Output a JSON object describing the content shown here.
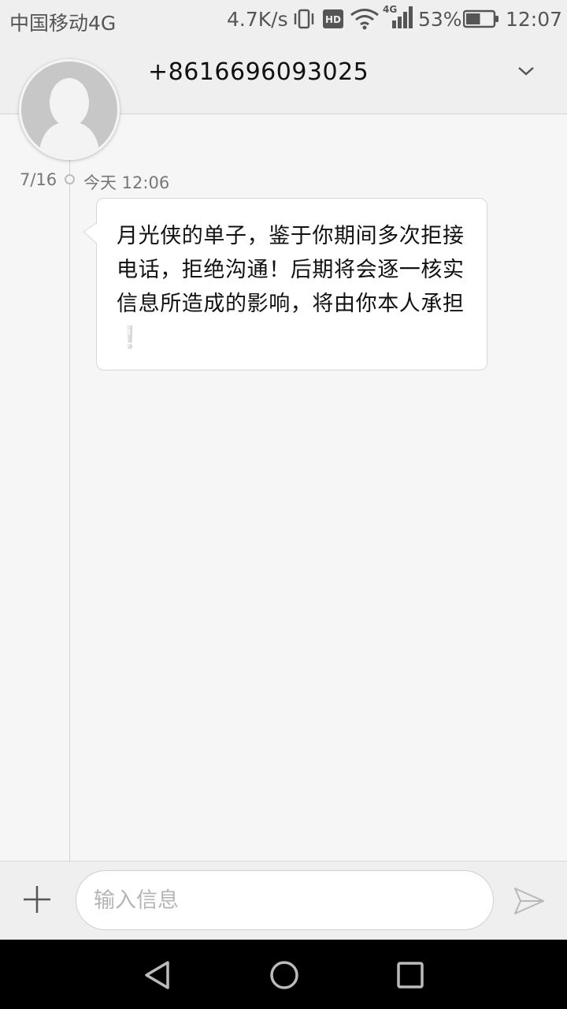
{
  "status_bar": {
    "carrier": "中国移动4G",
    "network_speed": "4.7K/s",
    "hd_badge": "HD",
    "network_type": "4G",
    "battery_percent": "53%",
    "battery_level": 0.53,
    "time": "12:07",
    "icons": [
      "vibrate-icon",
      "hd-icon",
      "wifi-icon",
      "signal-icon",
      "battery-icon"
    ]
  },
  "header": {
    "contact_number": "+8616696093025",
    "expand_icon": "chevron-down-icon",
    "avatar_icon": "person-silhouette-icon"
  },
  "conversation": {
    "date": "7/16",
    "time": "今天 12:06",
    "message": {
      "text": "月光侠的单子，鉴于你期间多次拒接电话，拒绝沟通！后期将会逐一核实信息所造成的影响，将由你本人承担",
      "emoji": "❕"
    }
  },
  "composer": {
    "placeholder": "输入信息",
    "add_icon": "plus-icon",
    "send_icon": "send-icon"
  },
  "navigation": {
    "back_icon": "back-triangle-icon",
    "home_icon": "home-circle-icon",
    "recents_icon": "recents-square-icon"
  },
  "colors": {
    "background": "#f6f6f6",
    "bar": "#efefef",
    "emoji_accent": "#3cb4e6",
    "nav": "#000000"
  }
}
